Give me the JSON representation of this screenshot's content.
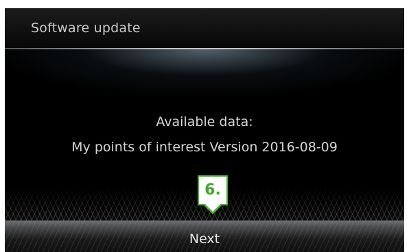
{
  "header": {
    "title": "Software update"
  },
  "main": {
    "line1": "Available data:",
    "line2": "My points of interest Version 2016-08-09"
  },
  "footer": {
    "next_label": "Next"
  },
  "annotation": {
    "step_label": "6."
  },
  "colors": {
    "background": "#000000",
    "text": "#d6d6d6",
    "callout_accent": "#4caf3a"
  }
}
